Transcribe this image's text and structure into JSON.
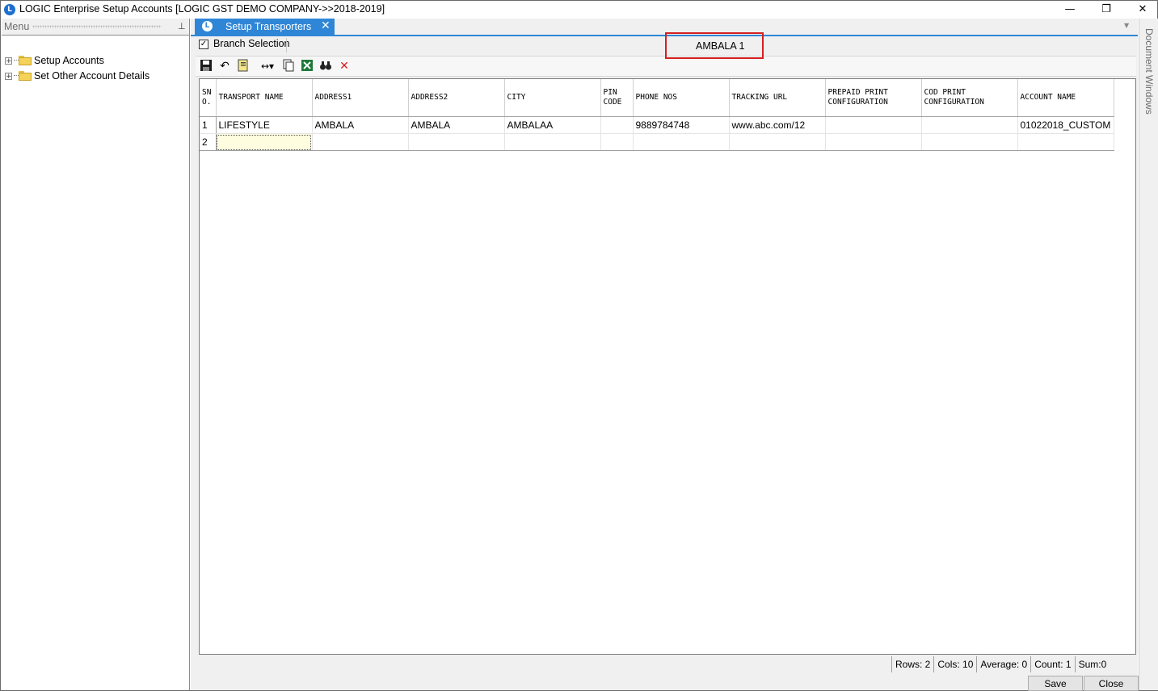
{
  "window": {
    "title": "LOGIC Enterprise Setup Accounts  [LOGIC GST DEMO COMPANY->>2018-2019]",
    "minimize": "—",
    "restore": "❐",
    "close": "✕"
  },
  "menu": {
    "label": "Menu",
    "items": [
      {
        "label": "Setup Accounts"
      },
      {
        "label": "Set Other Account Details"
      }
    ]
  },
  "tab": {
    "label": "Setup Transporters",
    "close": "✕"
  },
  "branch": {
    "checkbox_label": "Branch Selection",
    "checked": true,
    "value": "AMBALA 1"
  },
  "grid": {
    "columns": [
      "SN O.",
      "TRANSPORT NAME",
      "ADDRESS1",
      "ADDRESS2",
      "CITY",
      "PIN CODE",
      "PHONE NOS",
      "TRACKING URL",
      "PREPAID PRINT CONFIGURATION",
      "COD PRINT CONFIGURATION",
      "ACCOUNT NAME"
    ],
    "rows": [
      [
        "1",
        "LIFESTYLE",
        "AMBALA",
        "AMBALA",
        "AMBALAA",
        "",
        "9889784748",
        "www.abc.com/12",
        "",
        "",
        "01022018_CUSTOM"
      ],
      [
        "2",
        "",
        "",
        "",
        "",
        "",
        "",
        "",
        "",
        "",
        ""
      ]
    ]
  },
  "status": {
    "rows": "Rows: 2",
    "cols": "Cols: 10",
    "average": "Average: 0",
    "count": "Count: 1",
    "sum": "Sum:0"
  },
  "buttons": {
    "save": "Save",
    "close": "Close"
  },
  "side_panel": {
    "label": "Document Windows"
  },
  "colors": {
    "accent": "#2f86d6",
    "highlight": "#d62020"
  },
  "icons": [
    "save-icon",
    "undo-icon",
    "print-icon",
    "column-width-icon",
    "copy-icon",
    "excel-icon",
    "find-icon",
    "delete-icon"
  ]
}
